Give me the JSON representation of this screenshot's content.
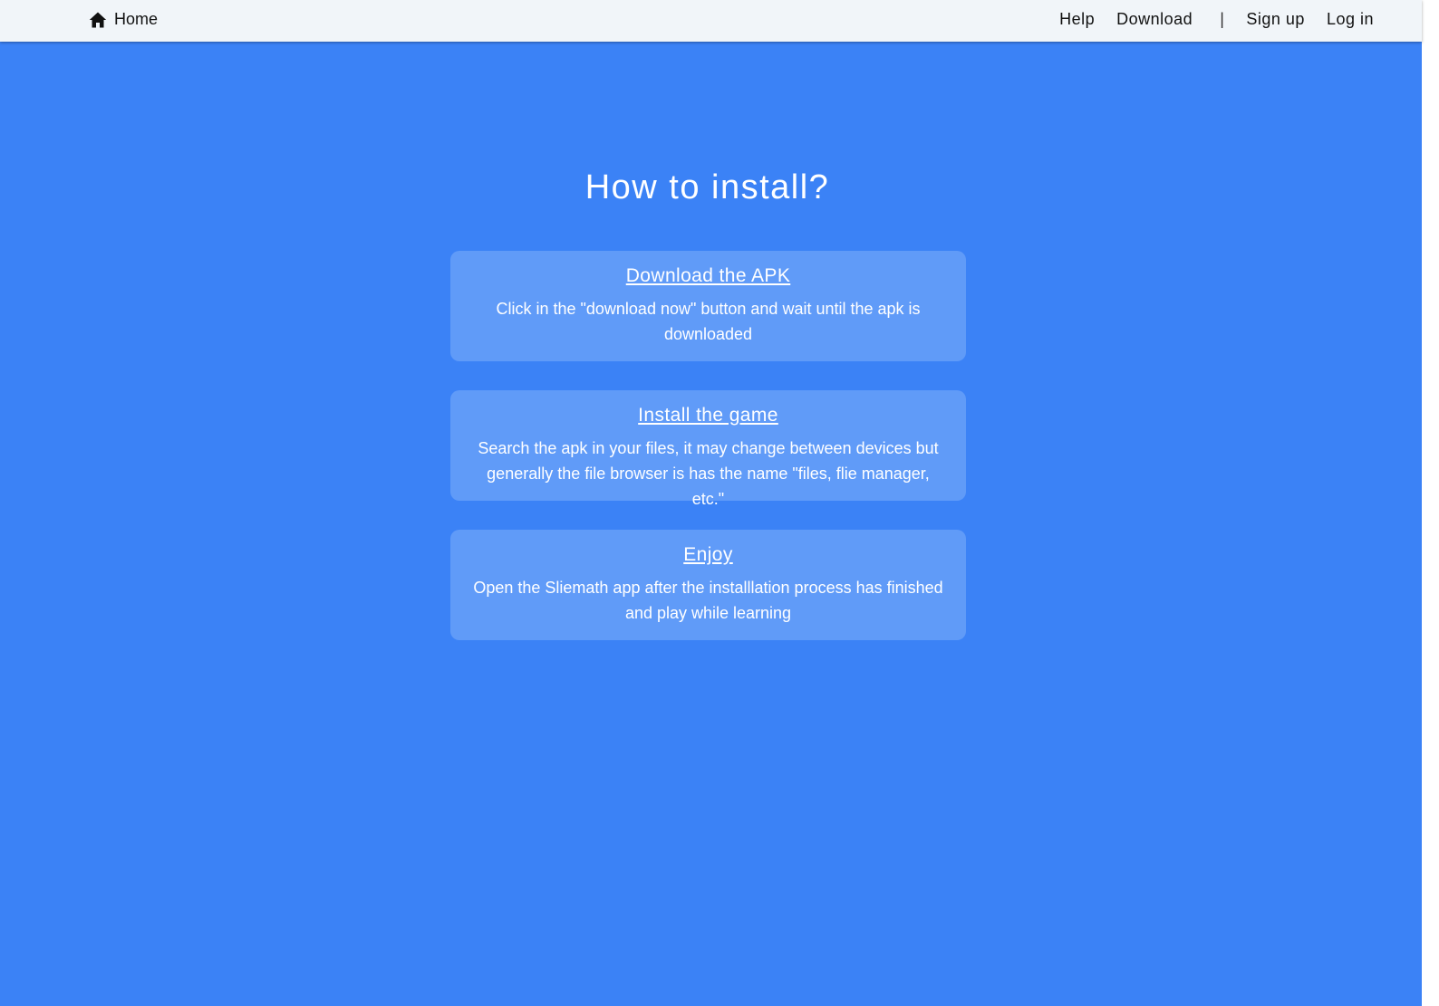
{
  "navbar": {
    "home_label": "Home",
    "help_label": "Help",
    "download_label": "Download",
    "separator": "|",
    "signup_label": "Sign up",
    "login_label": "Log in"
  },
  "main": {
    "title": "How to install?",
    "steps": [
      {
        "title": "Download the APK",
        "description": "Click in the \"download now\" button and wait until the apk is downloaded"
      },
      {
        "title": "Install the game",
        "description": "Search the apk in your files, it may change between devices but generally the file browser is has the name \"files, flie manager, etc.\""
      },
      {
        "title": "Enjoy",
        "description": "Open the Sliemath app after the installlation process has finished and play while learning"
      }
    ]
  },
  "colors": {
    "background": "#3b82f6",
    "card": "#609bf8",
    "navbar": "#f1f5f9"
  },
  "icons": {
    "home": "home-icon"
  }
}
